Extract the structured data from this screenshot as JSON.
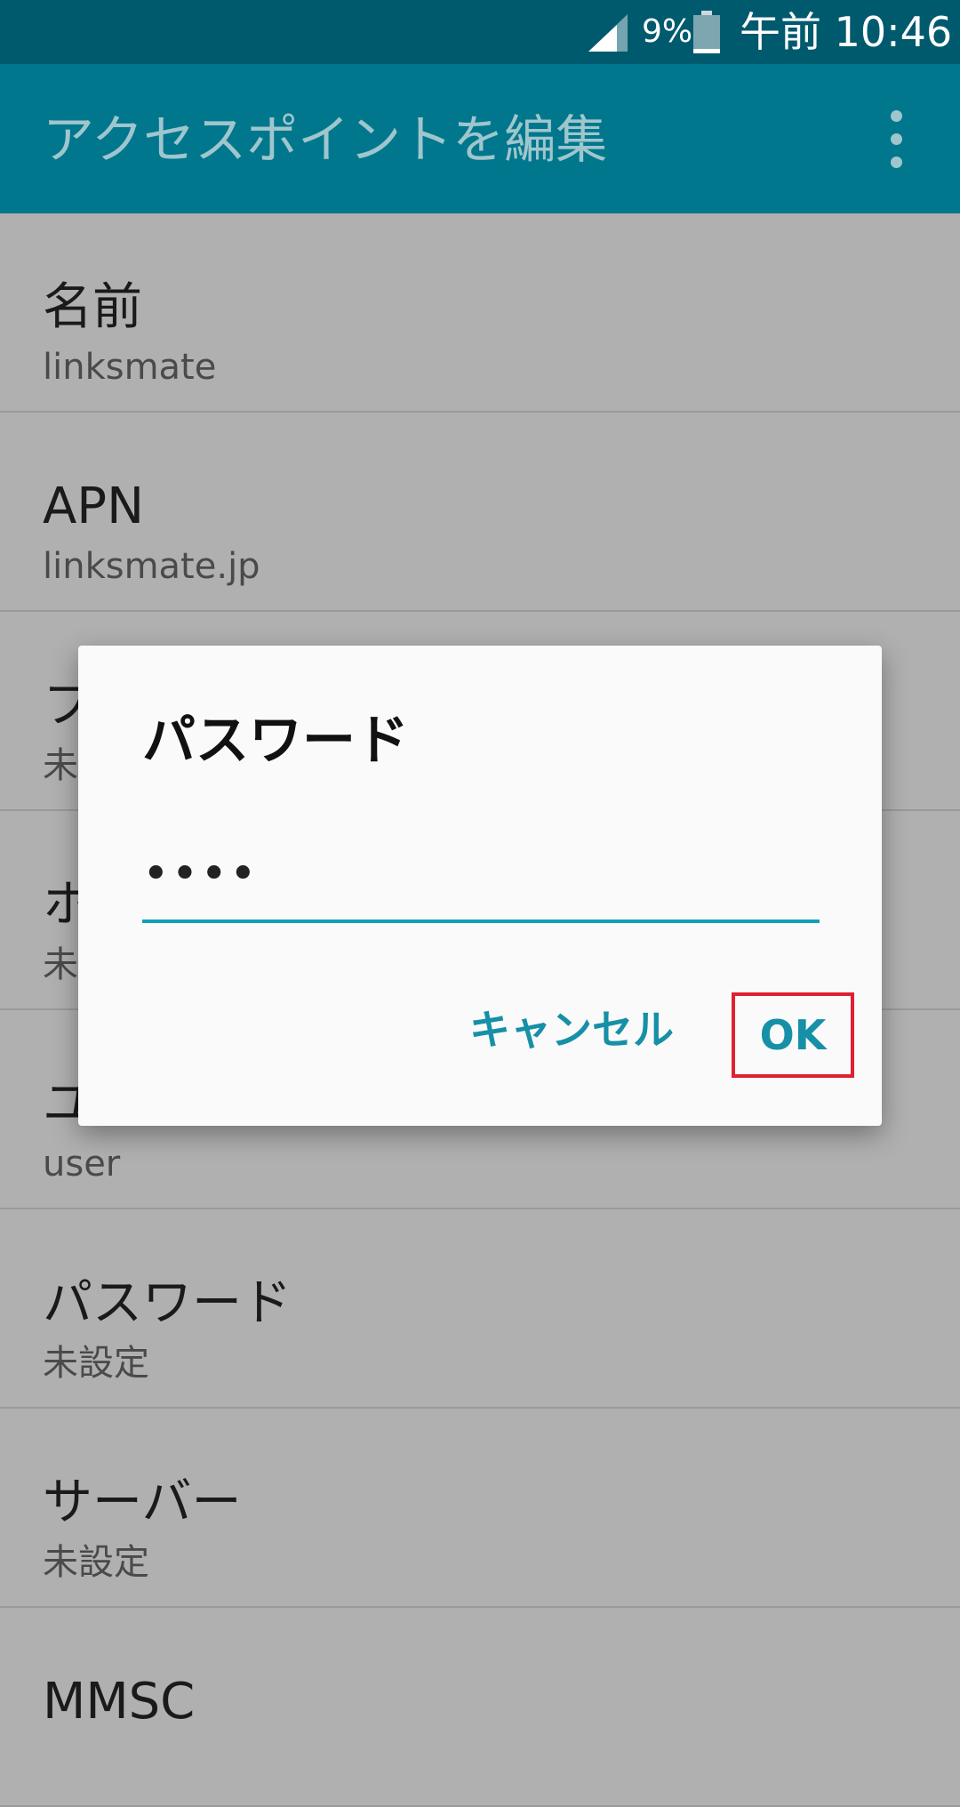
{
  "statusbar": {
    "battery_percent": "9%",
    "time": "午前 10:46"
  },
  "appbar": {
    "title": "アクセスポイントを編集"
  },
  "settings": [
    {
      "label": "名前",
      "value": "linksmate"
    },
    {
      "label": "APN",
      "value": "linksmate.jp"
    },
    {
      "label": "フ",
      "value": "未"
    },
    {
      "label": "ホ",
      "value": "未"
    },
    {
      "label": "ユ",
      "value": "user"
    },
    {
      "label": "パスワード",
      "value": "未設定"
    },
    {
      "label": "サーバー",
      "value": "未設定"
    },
    {
      "label": "MMSC",
      "value": ""
    }
  ],
  "dialog": {
    "title": "パスワード",
    "input_value": "••••",
    "cancel_label": "キャンセル",
    "ok_label": "OK"
  }
}
